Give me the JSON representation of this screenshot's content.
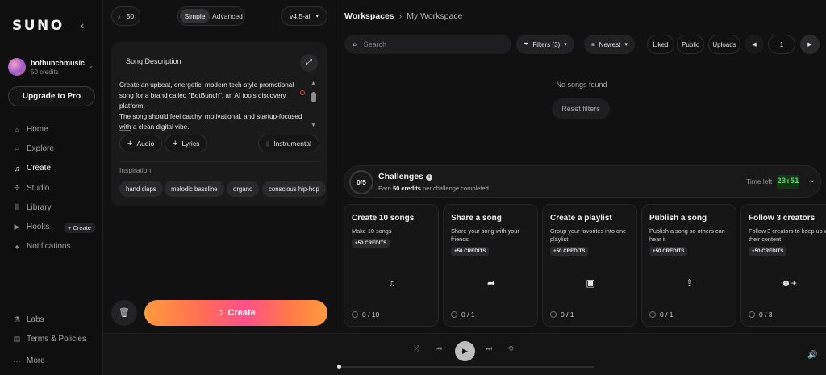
{
  "sidebar": {
    "logo": "SUNO",
    "collapse_icon": "‹",
    "profile": {
      "name": "botbunchmusic",
      "credits": "50 credits"
    },
    "upgrade": "Upgrade to Pro",
    "nav": [
      {
        "label": "Home",
        "icon": "home-icon"
      },
      {
        "label": "Explore",
        "icon": "search-icon"
      },
      {
        "label": "Create",
        "icon": "music-note-icon"
      },
      {
        "label": "Studio",
        "icon": "studio-icon"
      },
      {
        "label": "Library",
        "icon": "library-icon"
      },
      {
        "label": "Hooks",
        "icon": "hooks-icon"
      },
      {
        "label": "Notifications",
        "icon": "bell-icon"
      }
    ],
    "hooks_create": "+ Create",
    "bottom": [
      {
        "label": "Labs",
        "icon": "flask-icon"
      },
      {
        "label": "Terms & Policies",
        "icon": "document-icon"
      },
      {
        "label": "More",
        "icon": "more-icon"
      }
    ]
  },
  "create": {
    "credits_chip": "50",
    "mode": {
      "simple": "Simple",
      "advanced": "Advanced",
      "selected": "Simple"
    },
    "model": "v4.5-all",
    "card_title": "Song Description",
    "description_p1": "Create an upbeat, energetic, modern tech-style promotional song for a brand called \"BotBunch\", an AI tools discovery platform.",
    "description_p2a": "The song should feel catchy, motivational, and startup-focused ",
    "description_spell": "with",
    "description_p2b": " a clean digital vibe.",
    "audio": "Audio",
    "lyrics": "Lyrics",
    "instrumental": "Instrumental",
    "inspiration_title": "Inspiration",
    "tags": [
      "hand claps",
      "melodic bassline",
      "organo",
      "conscious hip-hop"
    ],
    "create_button": "Create"
  },
  "workspace": {
    "breadcrumb": {
      "root": "Workspaces",
      "current": "My Workspace"
    },
    "search_placeholder": "Search",
    "filters": "Filters (3)",
    "sort": "Newest",
    "options": [
      "Liked",
      "Public",
      "Uploads"
    ],
    "page": "1",
    "empty_text": "No songs found",
    "reset": "Reset filters"
  },
  "challenges": {
    "count": "0/5",
    "title": "Challenges",
    "subtitle_pre": "Earn ",
    "subtitle_bold": "50 credits",
    "subtitle_post": " per challenge completed",
    "time_label": "Time left",
    "time_value": "23:51",
    "items": [
      {
        "title": "Create 10 songs",
        "desc": "Make 10 songs",
        "badge": "+50 CREDITS",
        "progress": "0 / 10",
        "icon": "music-note-icon"
      },
      {
        "title": "Share a song",
        "desc": "Share your song with your friends",
        "badge": "+50 CREDITS",
        "progress": "0 / 1",
        "icon": "share-icon"
      },
      {
        "title": "Create a playlist",
        "desc": "Group your favorites into one playlist",
        "badge": "+50 CREDITS",
        "progress": "0 / 1",
        "icon": "playlist-icon"
      },
      {
        "title": "Publish a song",
        "desc": "Publish a song so others can hear it",
        "badge": "+50 CREDITS",
        "progress": "0 / 1",
        "icon": "upload-icon"
      },
      {
        "title": "Follow 3 creators",
        "desc": "Follow 3 creators to keep up with their content",
        "badge": "+50 CREDITS",
        "progress": "0 / 3",
        "icon": "add-user-icon"
      }
    ]
  },
  "player": {
    "progress": 0
  }
}
